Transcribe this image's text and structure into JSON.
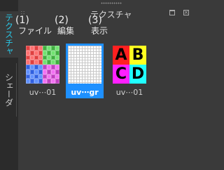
{
  "side_tabs": [
    {
      "label": "テクスチャ",
      "active": true
    },
    {
      "label": "シェーダ",
      "active": false
    }
  ],
  "panel": {
    "title": "テクスチャ",
    "restore_icon": "restore-window-icon",
    "close_icon": "close-icon"
  },
  "menu": {
    "file": {
      "number": "(1)",
      "label": "ファイル"
    },
    "edit": {
      "number": "(2)",
      "label": "編集"
    },
    "view": {
      "number": "(3)",
      "label": "表示"
    }
  },
  "textures": [
    {
      "label": "uv⋯01",
      "selected": false,
      "kind": "uv-checker"
    },
    {
      "label": "uv⋯gr",
      "selected": true,
      "kind": "grid"
    },
    {
      "label": "uv⋯01",
      "selected": false,
      "kind": "abcd"
    }
  ],
  "abcd": [
    "A",
    "B",
    "C",
    "D"
  ],
  "colors": {
    "active_tab": "#29c6e6",
    "selection": "#1e90ff",
    "background": "#3a3a3a"
  }
}
